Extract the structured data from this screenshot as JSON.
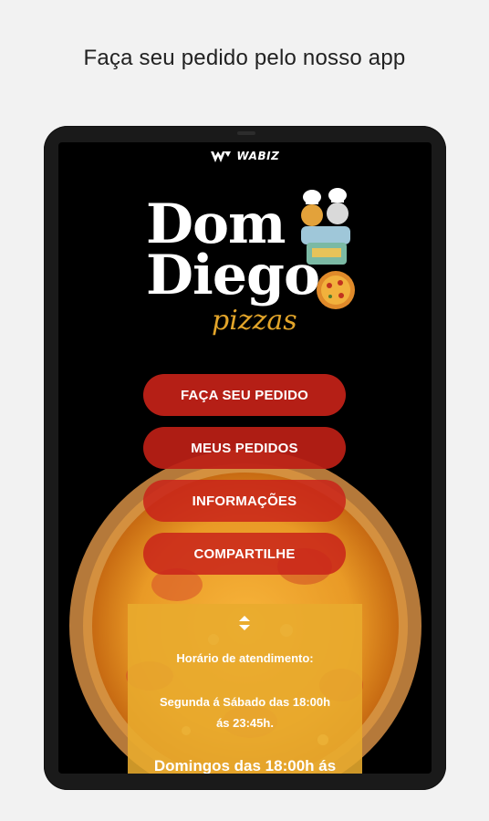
{
  "headline": "Faça seu pedido pelo nosso app",
  "brand": {
    "name": "WABIZ",
    "icon": "wabiz-logo-icon"
  },
  "logo": {
    "line1": "Dom",
    "line2": "Diego",
    "subtitle": "pizzas",
    "accent_color": "#e3a52a"
  },
  "menu": [
    {
      "label": "FAÇA SEU PEDIDO"
    },
    {
      "label": "MEUS PEDIDOS"
    },
    {
      "label": "INFORMAÇÕES"
    },
    {
      "label": "COMPARTILHE"
    }
  ],
  "info": {
    "title": "Horário de atendimento:",
    "weekdays_line1": "Segunda á Sábado das 18:00h",
    "weekdays_line2": "ás 23:45h.",
    "sunday": "Domingos das 18:00h ás",
    "toggle_icon": "expand-collapse-icon"
  },
  "colors": {
    "button_red": "#b51f16",
    "panel_orange": "#e8ab2d",
    "screen_bg": "#000000"
  }
}
